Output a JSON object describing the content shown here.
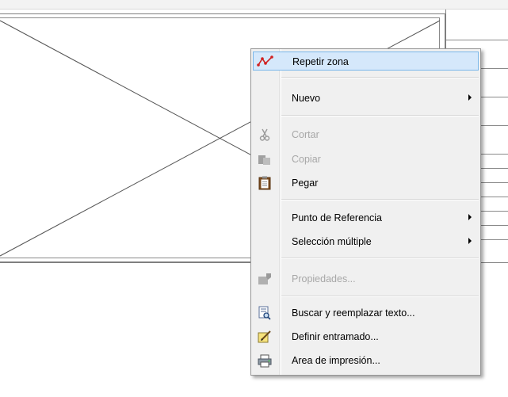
{
  "menu": {
    "items": [
      {
        "label": "Repetir zona",
        "icon": "repeat-zone-icon",
        "highlighted": true,
        "disabled": false,
        "submenu": false
      },
      {
        "label": "Nuevo",
        "icon": "",
        "highlighted": false,
        "disabled": false,
        "submenu": true
      },
      {
        "label": "Cortar",
        "icon": "scissors-icon",
        "highlighted": false,
        "disabled": true,
        "submenu": false
      },
      {
        "label": "Copiar",
        "icon": "copy-icon",
        "highlighted": false,
        "disabled": true,
        "submenu": false
      },
      {
        "label": "Pegar",
        "icon": "paste-icon",
        "highlighted": false,
        "disabled": false,
        "submenu": false
      },
      {
        "label": "Punto de Referencia",
        "icon": "",
        "highlighted": false,
        "disabled": false,
        "submenu": true
      },
      {
        "label": "Selección múltiple",
        "icon": "",
        "highlighted": false,
        "disabled": false,
        "submenu": true
      },
      {
        "label": "Propiedades...",
        "icon": "properties-icon",
        "highlighted": false,
        "disabled": true,
        "submenu": false
      },
      {
        "label": "Buscar y reemplazar texto...",
        "icon": "find-replace-icon",
        "highlighted": false,
        "disabled": false,
        "submenu": false
      },
      {
        "label": "Definir entramado...",
        "icon": "edit-pattern-icon",
        "highlighted": false,
        "disabled": false,
        "submenu": false
      },
      {
        "label": "Area de impresión...",
        "icon": "printer-icon",
        "highlighted": false,
        "disabled": false,
        "submenu": false
      }
    ]
  },
  "colors": {
    "highlight_bg": "#d5e8fb",
    "highlight_border": "#7ab7ea",
    "disabled_text": "#a7a7a7"
  }
}
